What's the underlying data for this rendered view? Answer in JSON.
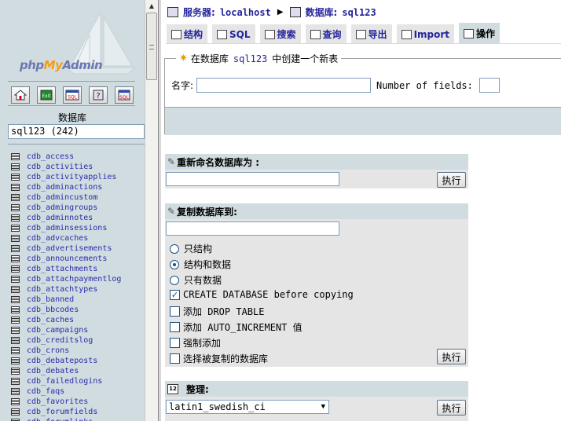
{
  "nav": {
    "brand": {
      "php": "php",
      "my": "My",
      "admin": "Admin"
    },
    "icons": [
      "home-icon",
      "exit-icon",
      "sql-icon",
      "help-icon",
      "query-window-icon"
    ],
    "db_label": "数据库",
    "db_select": "sql123 (242)",
    "tables": [
      "cdb_access",
      "cdb_activities",
      "cdb_activityapplies",
      "cdb_adminactions",
      "cdb_admincustom",
      "cdb_admingroups",
      "cdb_adminnotes",
      "cdb_adminsessions",
      "cdb_advcaches",
      "cdb_advertisements",
      "cdb_announcements",
      "cdb_attachments",
      "cdb_attachpaymentlog",
      "cdb_attachtypes",
      "cdb_banned",
      "cdb_bbcodes",
      "cdb_caches",
      "cdb_campaigns",
      "cdb_creditslog",
      "cdb_crons",
      "cdb_debateposts",
      "cdb_debates",
      "cdb_failedlogins",
      "cdb_faqs",
      "cdb_favorites",
      "cdb_forumfields",
      "cdb_forumlinks"
    ]
  },
  "breadcrumb": {
    "server_label": "服务器:",
    "server_value": "localhost",
    "db_label": "数据库:",
    "db_value": "sql123"
  },
  "tabs": [
    {
      "label": "结构",
      "icon": "structure-icon"
    },
    {
      "label": "SQL",
      "icon": "sql-icon"
    },
    {
      "label": "搜索",
      "icon": "search-icon"
    },
    {
      "label": "查询",
      "icon": "query-icon"
    },
    {
      "label": "导出",
      "icon": "export-icon"
    },
    {
      "label": "Import",
      "icon": "import-icon"
    },
    {
      "label": "操作",
      "icon": "tools-icon",
      "active": true
    }
  ],
  "create_table": {
    "legend_pre": "在数据库",
    "legend_db": "sql123",
    "legend_post": "中创建一个新表",
    "name_label": "名字:",
    "name_value": "",
    "fields_label": "Number of fields:",
    "fields_value": ""
  },
  "rename": {
    "title": "重新命名数据库为 :",
    "value": "",
    "button": "执行"
  },
  "copy": {
    "title": "复制数据库到:",
    "value": "",
    "radios": [
      {
        "label": "只结构",
        "checked": false
      },
      {
        "label": "结构和数据",
        "checked": true
      },
      {
        "label": "只有数据",
        "checked": false
      }
    ],
    "checkboxes": [
      {
        "label": "CREATE DATABASE before copying",
        "checked": true
      },
      {
        "label": "添加 DROP TABLE",
        "checked": false
      },
      {
        "label": "添加 AUTO_INCREMENT 值",
        "checked": false
      },
      {
        "label": "强制添加",
        "checked": false
      },
      {
        "label": "选择被复制的数据库",
        "checked": false
      }
    ],
    "button": "执行"
  },
  "collation": {
    "title": "整理:",
    "value": "latin1_swedish_ci",
    "button": "执行"
  }
}
